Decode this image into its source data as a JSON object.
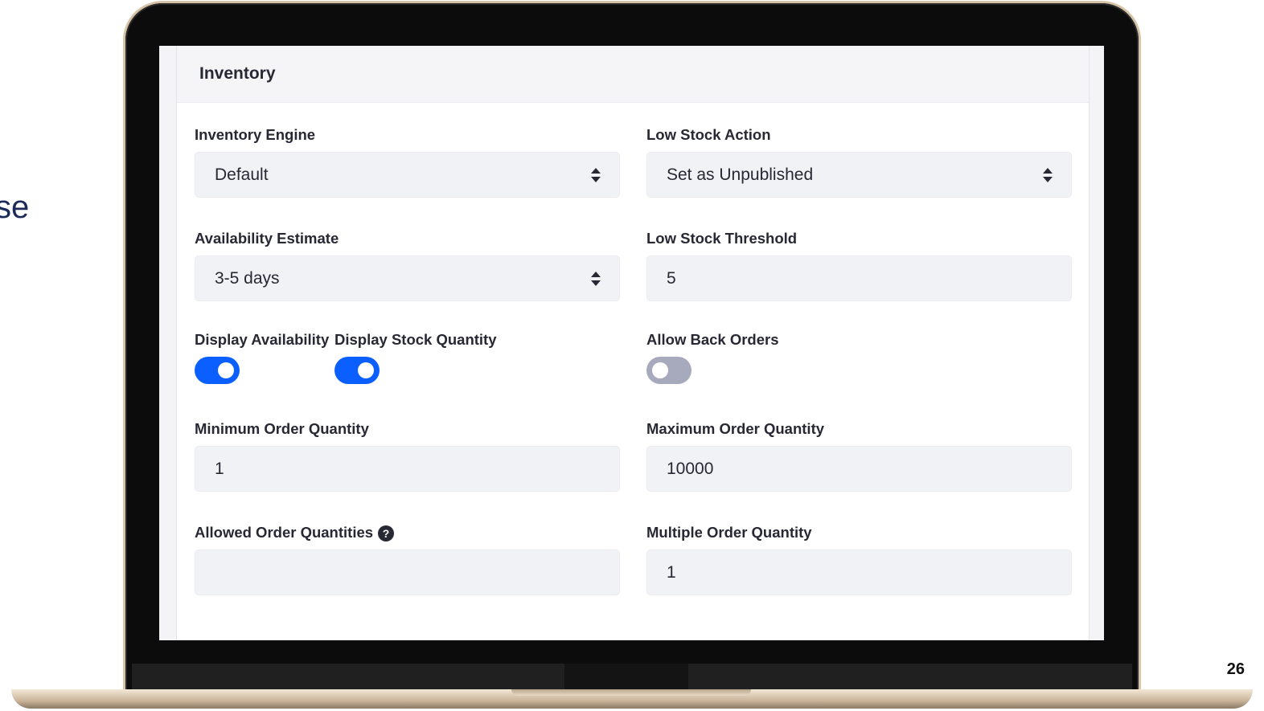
{
  "side_text": "se",
  "page_number": "26",
  "panel": {
    "title": "Inventory",
    "fields": {
      "inventory_engine": {
        "label": "Inventory Engine",
        "value": "Default"
      },
      "low_stock_action": {
        "label": "Low Stock Action",
        "value": "Set as Unpublished"
      },
      "availability_estimate": {
        "label": "Availability Estimate",
        "value": "3-5 days"
      },
      "low_stock_threshold": {
        "label": "Low Stock Threshold",
        "value": "5"
      },
      "display_availability": {
        "label": "Display Availability",
        "enabled": true
      },
      "display_stock_quantity": {
        "label": "Display Stock Quantity",
        "enabled": true
      },
      "allow_back_orders": {
        "label": "Allow Back Orders",
        "enabled": false
      },
      "minimum_order_quantity": {
        "label": "Minimum Order Quantity",
        "value": "1"
      },
      "maximum_order_quantity": {
        "label": "Maximum Order Quantity",
        "value": "10000"
      },
      "allowed_order_quantities": {
        "label": "Allowed Order Quantities",
        "value": "",
        "help_icon": "question-circle-icon"
      },
      "multiple_order_quantity": {
        "label": "Multiple Order Quantity",
        "value": "1"
      }
    }
  },
  "colors": {
    "toggle_on": "#0b5fff",
    "toggle_off": "#a7a9bc",
    "side_text": "#1c2a5a"
  }
}
